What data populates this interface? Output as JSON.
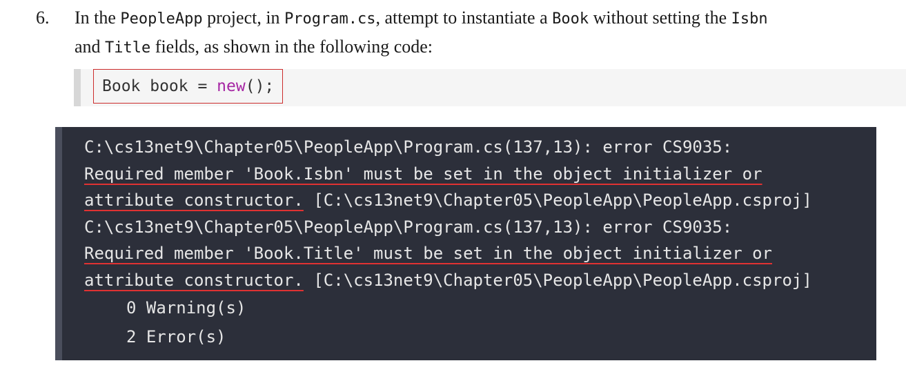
{
  "instruction": {
    "number": "6.",
    "line1_a": "In the ",
    "line1_code1": "PeopleApp",
    "line1_b": " project, in ",
    "line1_code2": "Program.cs",
    "line1_c": ", attempt to instantiate a ",
    "line1_code3": "Book",
    "line1_d": " without setting the ",
    "line1_code4": "Isbn",
    "line2_a": "and ",
    "line2_code1": "Title",
    "line2_b": " fields, as shown in the following code:"
  },
  "code": {
    "prefix": "Book book = ",
    "keyword": "new",
    "suffix": "();"
  },
  "terminal": {
    "error1_path": "C:\\cs13net9\\Chapter05\\PeopleApp\\Program.cs(137,13): error CS9035:",
    "error1_msg1": "Required member 'Book.Isbn' must be set in the object initializer or",
    "error1_msg2": "attribute constructor.",
    "error1_proj": " [C:\\cs13net9\\Chapter05\\PeopleApp\\PeopleApp.csproj]",
    "error2_path": "C:\\cs13net9\\Chapter05\\PeopleApp\\Program.cs(137,13): error CS9035:",
    "error2_msg1": "Required member 'Book.Title' must be set in the object initializer or",
    "error2_msg2": "attribute constructor.",
    "error2_proj": " [C:\\cs13net9\\Chapter05\\PeopleApp\\PeopleApp.csproj]",
    "warnings": "0 Warning(s)",
    "errors": "2 Error(s)"
  },
  "colors": {
    "highlight_border": "#cc2b2b",
    "keyword": "#a626a4",
    "underline": "#e03232",
    "terminal_bg": "#2c2f3a"
  }
}
